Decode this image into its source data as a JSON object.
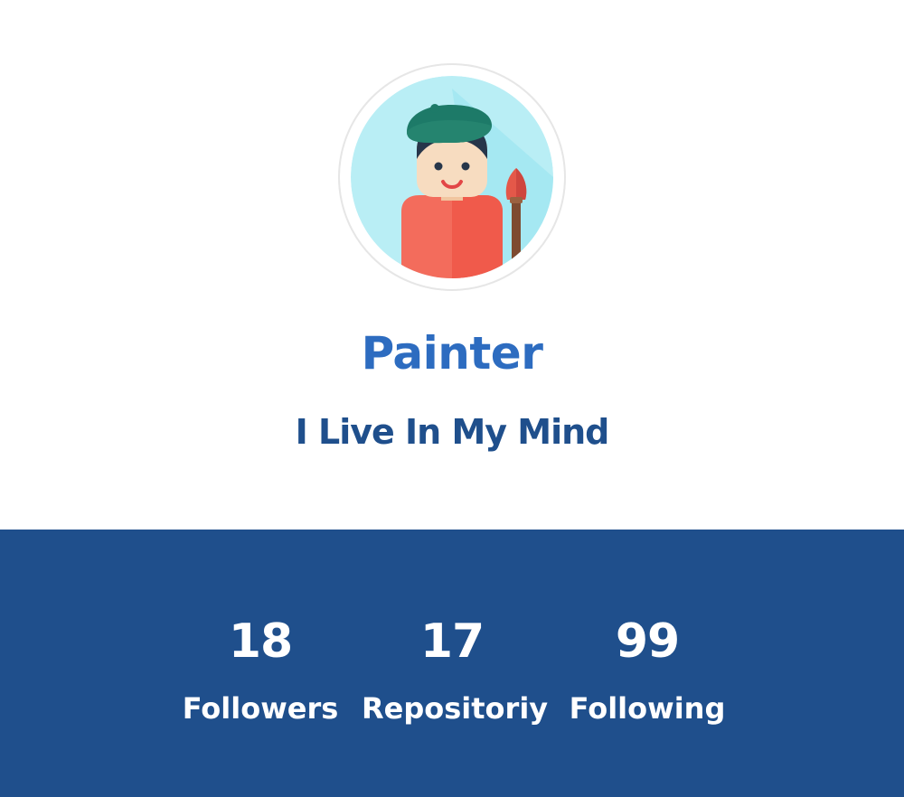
{
  "profile": {
    "name": "Painter",
    "tagline": "I Live In My Mind",
    "avatar_icon": "painter-avatar-icon"
  },
  "stats": [
    {
      "count": "18",
      "label": "Followers"
    },
    {
      "count": "17",
      "label": "Repositoriy"
    },
    {
      "count": "99",
      "label": "Following"
    }
  ],
  "colors": {
    "primary": "#2d6cc0",
    "dark": "#1f4f8c",
    "background": "#ffffff",
    "stat_text": "#ffffff"
  }
}
